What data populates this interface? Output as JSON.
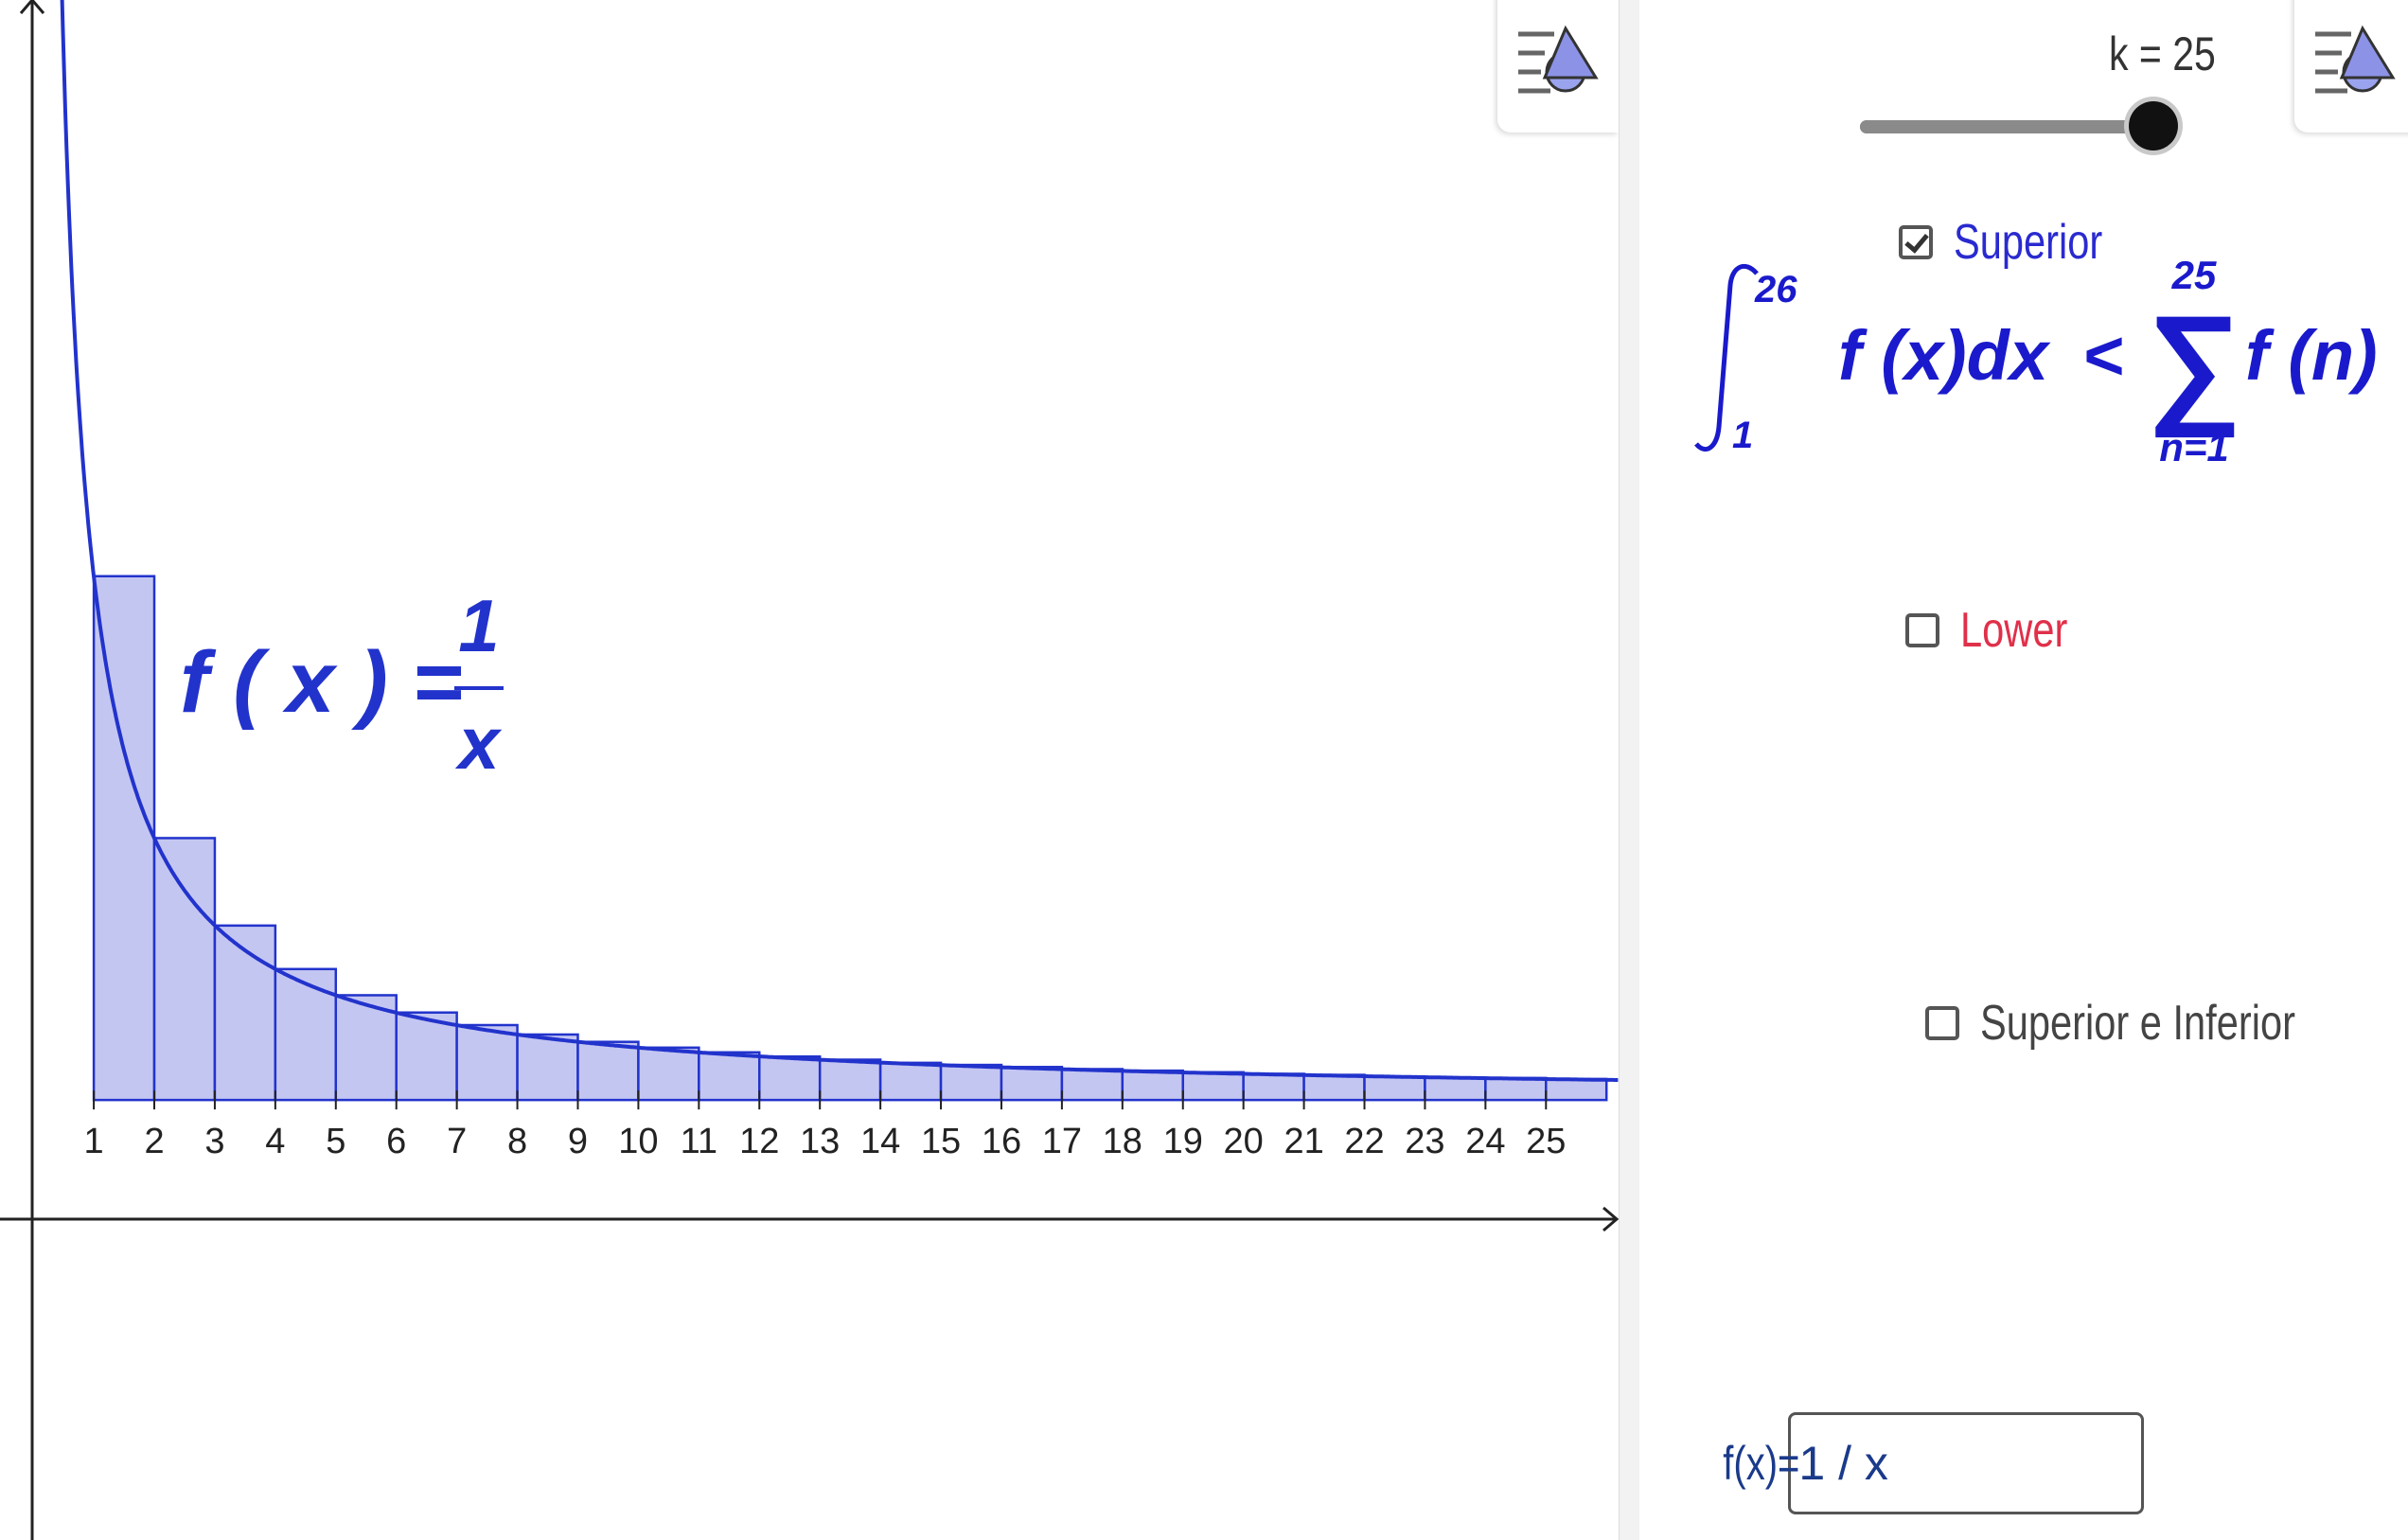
{
  "graphics": {
    "function_label": "f ( x ) =",
    "function_numerator": "1",
    "function_denominator": "x",
    "chart_data": {
      "type": "bar",
      "function": "1/x",
      "bar_mode": "upper sum (left endpoint heights)",
      "categories": [
        1,
        2,
        3,
        4,
        5,
        6,
        7,
        8,
        9,
        10,
        11,
        12,
        13,
        14,
        15,
        16,
        17,
        18,
        19,
        20,
        21,
        22,
        23,
        24,
        25
      ],
      "x_tick_labels": [
        "1",
        "2",
        "3",
        "4",
        "5",
        "6",
        "7",
        "8",
        "9",
        "10",
        "11",
        "12",
        "13",
        "14",
        "15",
        "16",
        "17",
        "18",
        "19",
        "20",
        "21",
        "22",
        "23",
        "24",
        "25"
      ],
      "series": [
        {
          "values": [
            1.0,
            0.5,
            0.333,
            0.25,
            0.2,
            0.167,
            0.143,
            0.125,
            0.111,
            0.1,
            0.091,
            0.083,
            0.077,
            0.071,
            0.067,
            0.063,
            0.059,
            0.056,
            0.053,
            0.05,
            0.048,
            0.045,
            0.043,
            0.042,
            0.04
          ]
        }
      ],
      "curve_color": "#2233cc",
      "bar_fill": "#c4c6f2",
      "bar_stroke": "#2233cc",
      "xlim": [
        -0.55,
        26.2
      ],
      "ylim": [
        -0.84,
        2.1
      ]
    }
  },
  "controls": {
    "slider_label": "k = 25",
    "slider": {
      "min": 1,
      "max": 25,
      "value": 25
    },
    "superior_label": "Superior",
    "superior_checked": true,
    "lower_label": "Lower",
    "lower_checked": false,
    "both_label": "Superior e Inferior",
    "both_checked": false,
    "formula": {
      "integral_upper": "26",
      "integral_lower": "1",
      "integrand": "f (x)dx",
      "relation": "<",
      "sum_upper": "25",
      "sum_lower": "n=1",
      "summand": "f (n)"
    },
    "input_label": "f(x)=",
    "input_value": "1 / x"
  },
  "colors": {
    "superior": "#2a2ad0",
    "lower": "#e0304a",
    "both": "#444444",
    "formula": "#1a1acc"
  },
  "icons": {
    "style_bar": "style-bar-toggle-icon"
  }
}
